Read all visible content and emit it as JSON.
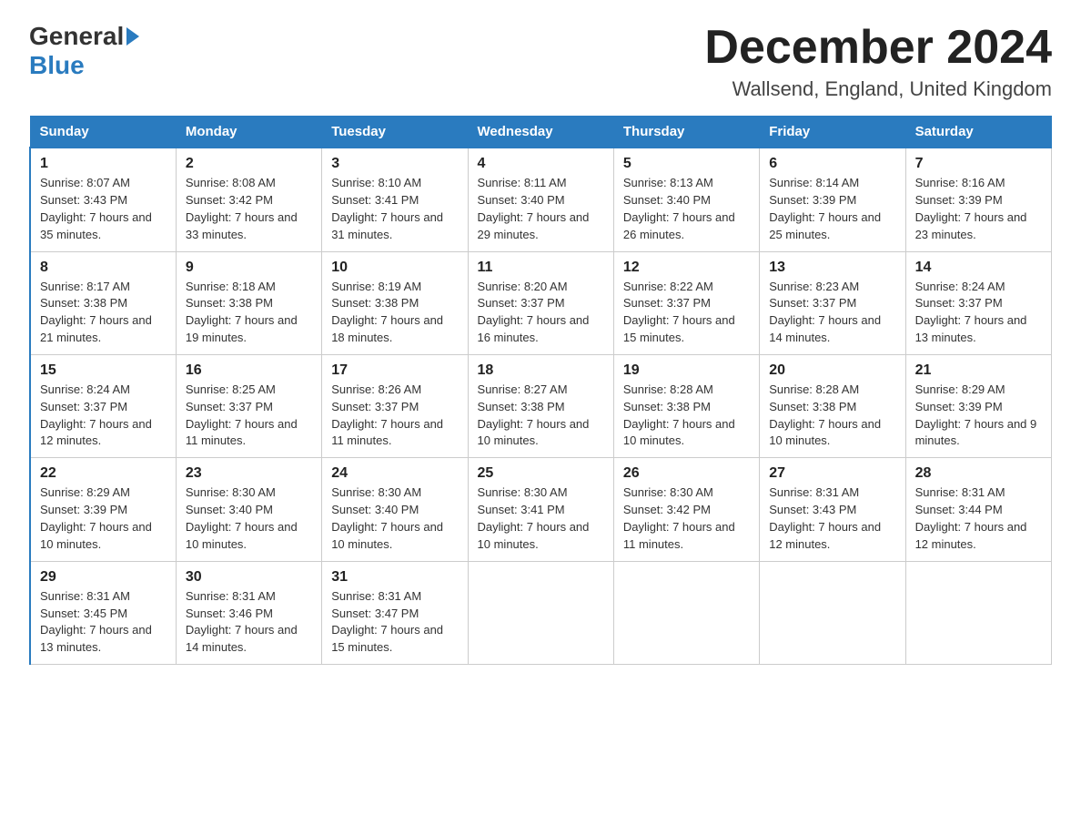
{
  "header": {
    "month_title": "December 2024",
    "location": "Wallsend, England, United Kingdom",
    "logo_general": "General",
    "logo_blue": "Blue"
  },
  "columns": [
    "Sunday",
    "Monday",
    "Tuesday",
    "Wednesday",
    "Thursday",
    "Friday",
    "Saturday"
  ],
  "weeks": [
    [
      {
        "day": "1",
        "sunrise": "Sunrise: 8:07 AM",
        "sunset": "Sunset: 3:43 PM",
        "daylight": "Daylight: 7 hours and 35 minutes."
      },
      {
        "day": "2",
        "sunrise": "Sunrise: 8:08 AM",
        "sunset": "Sunset: 3:42 PM",
        "daylight": "Daylight: 7 hours and 33 minutes."
      },
      {
        "day": "3",
        "sunrise": "Sunrise: 8:10 AM",
        "sunset": "Sunset: 3:41 PM",
        "daylight": "Daylight: 7 hours and 31 minutes."
      },
      {
        "day": "4",
        "sunrise": "Sunrise: 8:11 AM",
        "sunset": "Sunset: 3:40 PM",
        "daylight": "Daylight: 7 hours and 29 minutes."
      },
      {
        "day": "5",
        "sunrise": "Sunrise: 8:13 AM",
        "sunset": "Sunset: 3:40 PM",
        "daylight": "Daylight: 7 hours and 26 minutes."
      },
      {
        "day": "6",
        "sunrise": "Sunrise: 8:14 AM",
        "sunset": "Sunset: 3:39 PM",
        "daylight": "Daylight: 7 hours and 25 minutes."
      },
      {
        "day": "7",
        "sunrise": "Sunrise: 8:16 AM",
        "sunset": "Sunset: 3:39 PM",
        "daylight": "Daylight: 7 hours and 23 minutes."
      }
    ],
    [
      {
        "day": "8",
        "sunrise": "Sunrise: 8:17 AM",
        "sunset": "Sunset: 3:38 PM",
        "daylight": "Daylight: 7 hours and 21 minutes."
      },
      {
        "day": "9",
        "sunrise": "Sunrise: 8:18 AM",
        "sunset": "Sunset: 3:38 PM",
        "daylight": "Daylight: 7 hours and 19 minutes."
      },
      {
        "day": "10",
        "sunrise": "Sunrise: 8:19 AM",
        "sunset": "Sunset: 3:38 PM",
        "daylight": "Daylight: 7 hours and 18 minutes."
      },
      {
        "day": "11",
        "sunrise": "Sunrise: 8:20 AM",
        "sunset": "Sunset: 3:37 PM",
        "daylight": "Daylight: 7 hours and 16 minutes."
      },
      {
        "day": "12",
        "sunrise": "Sunrise: 8:22 AM",
        "sunset": "Sunset: 3:37 PM",
        "daylight": "Daylight: 7 hours and 15 minutes."
      },
      {
        "day": "13",
        "sunrise": "Sunrise: 8:23 AM",
        "sunset": "Sunset: 3:37 PM",
        "daylight": "Daylight: 7 hours and 14 minutes."
      },
      {
        "day": "14",
        "sunrise": "Sunrise: 8:24 AM",
        "sunset": "Sunset: 3:37 PM",
        "daylight": "Daylight: 7 hours and 13 minutes."
      }
    ],
    [
      {
        "day": "15",
        "sunrise": "Sunrise: 8:24 AM",
        "sunset": "Sunset: 3:37 PM",
        "daylight": "Daylight: 7 hours and 12 minutes."
      },
      {
        "day": "16",
        "sunrise": "Sunrise: 8:25 AM",
        "sunset": "Sunset: 3:37 PM",
        "daylight": "Daylight: 7 hours and 11 minutes."
      },
      {
        "day": "17",
        "sunrise": "Sunrise: 8:26 AM",
        "sunset": "Sunset: 3:37 PM",
        "daylight": "Daylight: 7 hours and 11 minutes."
      },
      {
        "day": "18",
        "sunrise": "Sunrise: 8:27 AM",
        "sunset": "Sunset: 3:38 PM",
        "daylight": "Daylight: 7 hours and 10 minutes."
      },
      {
        "day": "19",
        "sunrise": "Sunrise: 8:28 AM",
        "sunset": "Sunset: 3:38 PM",
        "daylight": "Daylight: 7 hours and 10 minutes."
      },
      {
        "day": "20",
        "sunrise": "Sunrise: 8:28 AM",
        "sunset": "Sunset: 3:38 PM",
        "daylight": "Daylight: 7 hours and 10 minutes."
      },
      {
        "day": "21",
        "sunrise": "Sunrise: 8:29 AM",
        "sunset": "Sunset: 3:39 PM",
        "daylight": "Daylight: 7 hours and 9 minutes."
      }
    ],
    [
      {
        "day": "22",
        "sunrise": "Sunrise: 8:29 AM",
        "sunset": "Sunset: 3:39 PM",
        "daylight": "Daylight: 7 hours and 10 minutes."
      },
      {
        "day": "23",
        "sunrise": "Sunrise: 8:30 AM",
        "sunset": "Sunset: 3:40 PM",
        "daylight": "Daylight: 7 hours and 10 minutes."
      },
      {
        "day": "24",
        "sunrise": "Sunrise: 8:30 AM",
        "sunset": "Sunset: 3:40 PM",
        "daylight": "Daylight: 7 hours and 10 minutes."
      },
      {
        "day": "25",
        "sunrise": "Sunrise: 8:30 AM",
        "sunset": "Sunset: 3:41 PM",
        "daylight": "Daylight: 7 hours and 10 minutes."
      },
      {
        "day": "26",
        "sunrise": "Sunrise: 8:30 AM",
        "sunset": "Sunset: 3:42 PM",
        "daylight": "Daylight: 7 hours and 11 minutes."
      },
      {
        "day": "27",
        "sunrise": "Sunrise: 8:31 AM",
        "sunset": "Sunset: 3:43 PM",
        "daylight": "Daylight: 7 hours and 12 minutes."
      },
      {
        "day": "28",
        "sunrise": "Sunrise: 8:31 AM",
        "sunset": "Sunset: 3:44 PM",
        "daylight": "Daylight: 7 hours and 12 minutes."
      }
    ],
    [
      {
        "day": "29",
        "sunrise": "Sunrise: 8:31 AM",
        "sunset": "Sunset: 3:45 PM",
        "daylight": "Daylight: 7 hours and 13 minutes."
      },
      {
        "day": "30",
        "sunrise": "Sunrise: 8:31 AM",
        "sunset": "Sunset: 3:46 PM",
        "daylight": "Daylight: 7 hours and 14 minutes."
      },
      {
        "day": "31",
        "sunrise": "Sunrise: 8:31 AM",
        "sunset": "Sunset: 3:47 PM",
        "daylight": "Daylight: 7 hours and 15 minutes."
      },
      null,
      null,
      null,
      null
    ]
  ]
}
